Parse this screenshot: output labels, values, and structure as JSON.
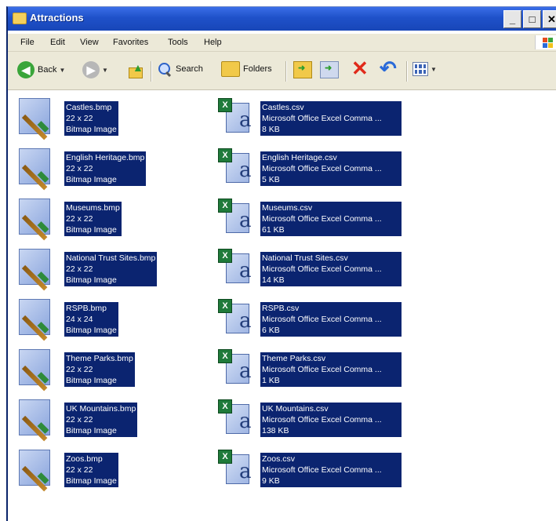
{
  "window": {
    "title": "Attractions"
  },
  "menu": [
    "File",
    "Edit",
    "View",
    "Favorites",
    "Tools",
    "Help"
  ],
  "toolbar": {
    "back": "Back",
    "search": "Search",
    "folders": "Folders"
  },
  "left_items": [
    {
      "name": "Castles.bmp",
      "dims": "22 x 22",
      "type": "Bitmap Image"
    },
    {
      "name": "English Heritage.bmp",
      "dims": "22 x 22",
      "type": "Bitmap Image"
    },
    {
      "name": "Museums.bmp",
      "dims": "22 x 22",
      "type": "Bitmap Image"
    },
    {
      "name": "National Trust Sites.bmp",
      "dims": "22 x 22",
      "type": "Bitmap Image"
    },
    {
      "name": "RSPB.bmp",
      "dims": "24 x 24",
      "type": "Bitmap Image"
    },
    {
      "name": "Theme Parks.bmp",
      "dims": "22 x 22",
      "type": "Bitmap Image"
    },
    {
      "name": "UK Mountains.bmp",
      "dims": "22 x 22",
      "type": "Bitmap Image"
    },
    {
      "name": "Zoos.bmp",
      "dims": "22 x 22",
      "type": "Bitmap Image"
    }
  ],
  "right_items": [
    {
      "name": "Castles.csv",
      "type": "Microsoft Office Excel Comma ...",
      "size": "8 KB"
    },
    {
      "name": "English Heritage.csv",
      "type": "Microsoft Office Excel Comma ...",
      "size": "5 KB"
    },
    {
      "name": "Museums.csv",
      "type": "Microsoft Office Excel Comma ...",
      "size": "61 KB"
    },
    {
      "name": "National Trust Sites.csv",
      "type": "Microsoft Office Excel Comma ...",
      "size": "14 KB"
    },
    {
      "name": "RSPB.csv",
      "type": "Microsoft Office Excel Comma ...",
      "size": "6 KB"
    },
    {
      "name": "Theme Parks.csv",
      "type": "Microsoft Office Excel Comma ...",
      "size": "1 KB"
    },
    {
      "name": "UK Mountains.csv",
      "type": "Microsoft Office Excel Comma ...",
      "size": "138 KB"
    },
    {
      "name": "Zoos.csv",
      "type": "Microsoft Office Excel Comma ...",
      "size": "9 KB"
    }
  ]
}
